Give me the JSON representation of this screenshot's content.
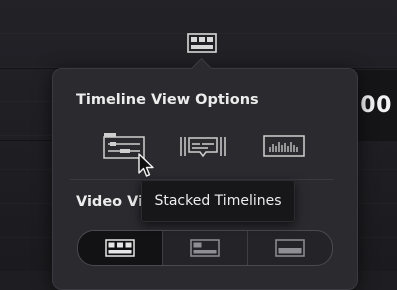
{
  "timecode": {
    "text": ":00"
  },
  "toolbar": {
    "view_options_icon": "timeline-view-options-icon"
  },
  "popup": {
    "timeline_section": {
      "title": "Timeline View Options",
      "options": [
        {
          "icon": "stacked-timelines-icon",
          "selected": true
        },
        {
          "icon": "subtitle-tracks-icon",
          "selected": false
        },
        {
          "icon": "audio-waveform-icon",
          "selected": false
        }
      ]
    },
    "video_section": {
      "title": "Video View Options",
      "buttons": [
        {
          "icon": "filmstrip-view-icon",
          "active": true
        },
        {
          "icon": "thumbnail-view-icon",
          "active": false
        },
        {
          "icon": "simple-view-icon",
          "active": false
        }
      ]
    }
  },
  "tooltip": {
    "text": "Stacked Timelines"
  },
  "colors": {
    "background": "#1e1e22",
    "popup": "#2a2a2f",
    "icon": "#d8d8d8",
    "tooltip": "#17171a"
  }
}
